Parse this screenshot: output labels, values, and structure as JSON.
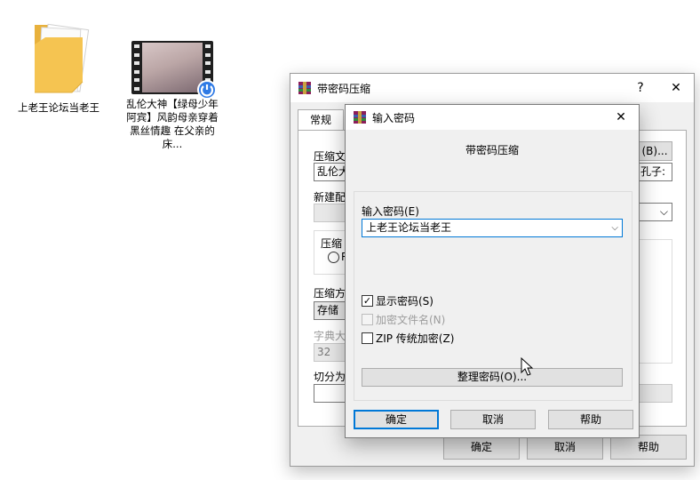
{
  "desktop": {
    "folder_label": "上老王论坛当老王",
    "video_label": "乱伦大神【绿母少年阿宾】风韵母亲穿着黑丝情趣 在父亲的床..."
  },
  "archive_window": {
    "title": "带密码压缩",
    "help_glyph": "?",
    "close_glyph": "✕",
    "tab_general": "常规",
    "label_archive_name": "压缩文",
    "archive_name_value": "乱伦大",
    "browse_button": "(B)...",
    "right_combo_value": "孔子:",
    "label_new_profile": "新建配",
    "label_compress_type": "压缩",
    "radio_char": "R",
    "label_method": "压缩方",
    "method_value": "存储",
    "label_dict": "字典大",
    "dict_value": "32",
    "label_split": "切分为",
    "ok_button": "确定",
    "cancel_button": "取消",
    "help_button": "帮助"
  },
  "password_dialog": {
    "title": "输入密码",
    "close_glyph": "✕",
    "heading": "带密码压缩",
    "password_label": "输入密码(E)",
    "password_value": "上老王论坛当老王",
    "combo_arrow": "⌵",
    "show_password_label": "显示密码(S)",
    "show_password_checked": true,
    "encrypt_names_label": "加密文件名(N)",
    "encrypt_names_checked": false,
    "zip_legacy_label": "ZIP 传统加密(Z)",
    "zip_legacy_checked": false,
    "organize_button": "整理密码(O)...",
    "ok_button": "确定",
    "cancel_button": "取消",
    "help_button": "帮助"
  },
  "colors": {
    "accent": "#0078d7",
    "folder": "#f5c451"
  }
}
